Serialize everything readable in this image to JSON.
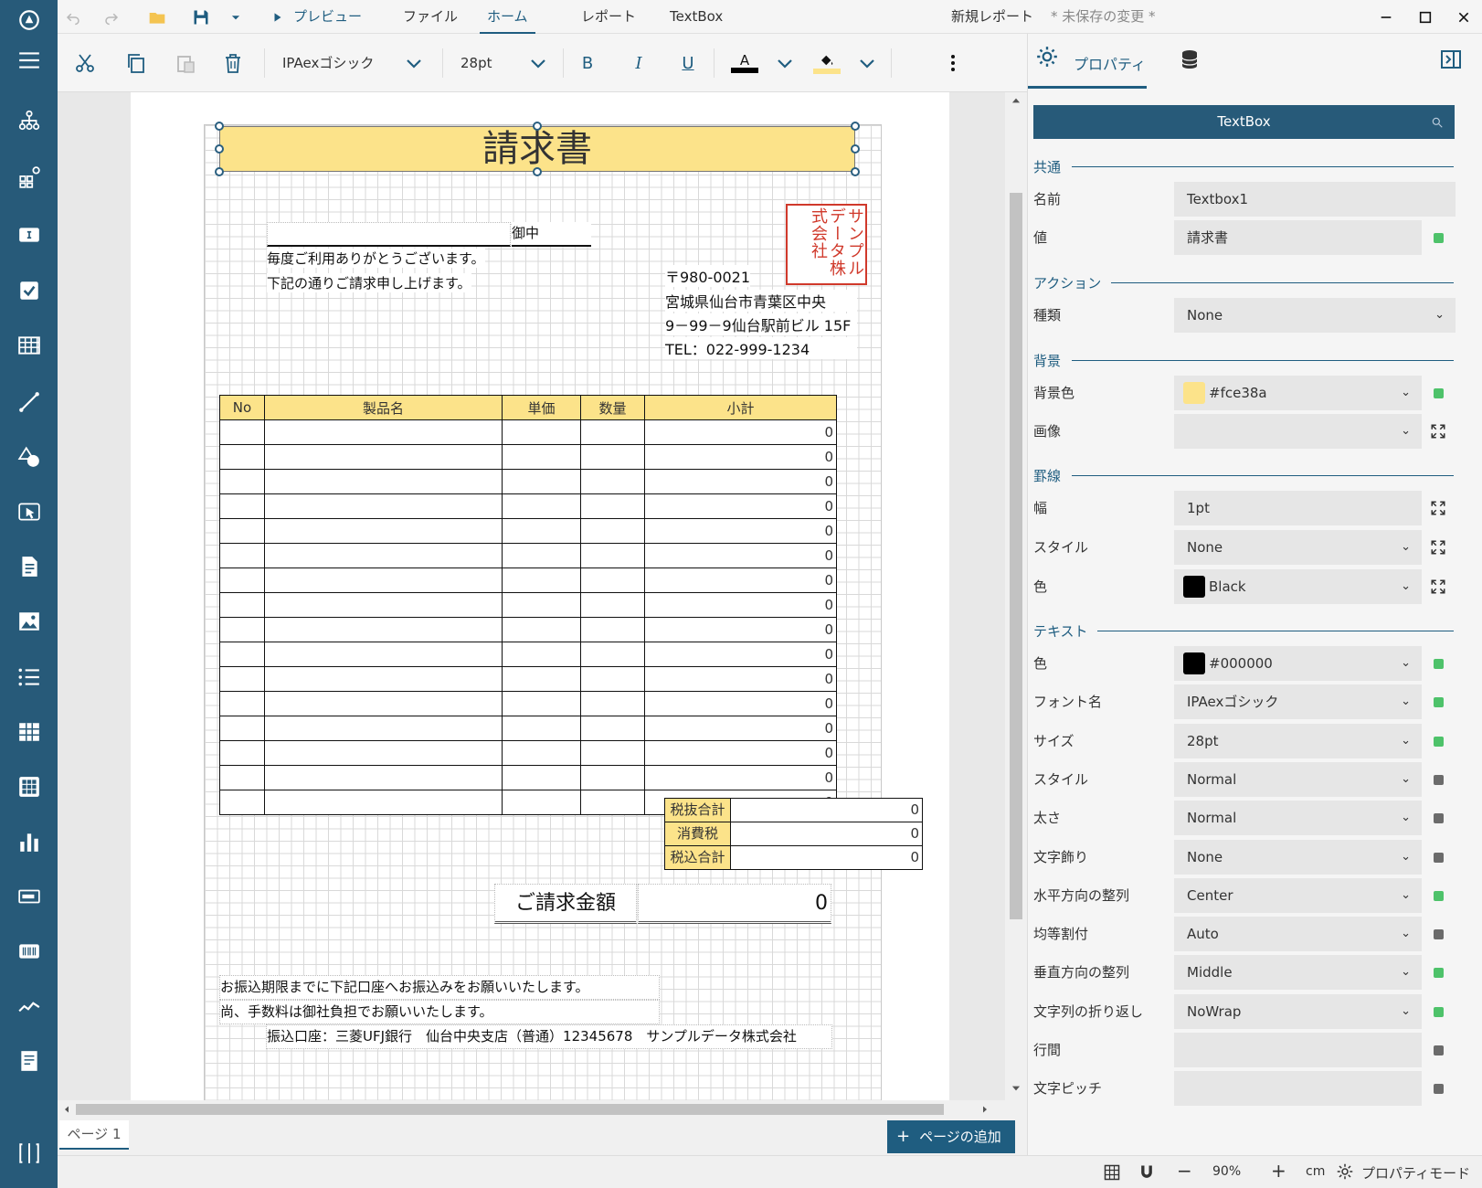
{
  "titlebar": {
    "menu_preview": "プレビュー",
    "menu_file": "ファイル",
    "menu_home": "ホーム",
    "menu_report": "レポート",
    "menu_textbox": "TextBox",
    "doc_name": "新規レポート",
    "unsaved": "* 未保存の変更 *"
  },
  "toolbar": {
    "font_name": "IPAexゴシック",
    "font_size": "28pt",
    "bold": "B",
    "italic": "I",
    "underline": "U",
    "font_color_letter": "A"
  },
  "report": {
    "title": "請求書",
    "onchu": "御中",
    "greeting1": "毎度ご利用ありがとうございます。",
    "greeting2": "下記の通りご請求申し上げます。",
    "stamp": "サンプルデータ株式会社",
    "postal": "〒980-0021",
    "address1": "宮城県仙台市青葉区中央",
    "address2": "9－99－9仙台駅前ビル 15F",
    "tel": "TEL：022-999-1234",
    "headers": [
      "No",
      "製品名",
      "単価",
      "数量",
      "小計"
    ],
    "row_subtotals": [
      "0",
      "0",
      "0",
      "0",
      "0",
      "0",
      "0",
      "0",
      "0",
      "0",
      "0",
      "0",
      "0",
      "0",
      "0",
      "0"
    ],
    "subtotal_label": "税抜合計",
    "tax_label": "消費税",
    "total_label": "税込合計",
    "subtotal_value": "0",
    "tax_value": "0",
    "total_value": "0",
    "amount_label": "ご請求金額",
    "amount_value": "0",
    "note1": "お振込期限までに下記口座へお振込みをお願いいたします。",
    "note2": "尚、手数料は御社負担でお願いいたします。",
    "bank": "振込口座：三菱UFJ銀行　仙台中央支店（普通）12345678　サンプルデータ株式会社"
  },
  "pagebar": {
    "page_tab": "ページ 1",
    "add_page": "ページの追加"
  },
  "statusbar": {
    "zoom": "90%",
    "unit": "cm",
    "mode": "プロパティモード"
  },
  "props": {
    "tab_label": "プロパティ",
    "search_value": "TextBox",
    "sections": {
      "common": "共通",
      "action": "アクション",
      "background": "背景",
      "border": "罫線",
      "text": "テキスト"
    },
    "name_label": "名前",
    "name_value": "Textbox1",
    "value_label": "値",
    "value_value": "請求書",
    "action_kind_label": "種類",
    "action_kind_value": "None",
    "bg_color_label": "背景色",
    "bg_color_value": "#fce38a",
    "image_label": "画像",
    "image_value": "",
    "border_width_label": "幅",
    "border_width_value": "1pt",
    "border_style_label": "スタイル",
    "border_style_value": "None",
    "border_color_label": "色",
    "border_color_value": "Black",
    "text_color_label": "色",
    "text_color_value": "#000000",
    "font_name_label": "フォント名",
    "font_name_value": "IPAexゴシック",
    "size_label": "サイズ",
    "size_value": "28pt",
    "style_label": "スタイル",
    "style_value": "Normal",
    "weight_label": "太さ",
    "weight_value": "Normal",
    "decoration_label": "文字飾り",
    "decoration_value": "None",
    "halign_label": "水平方向の整列",
    "halign_value": "Center",
    "justify_label": "均等割付",
    "justify_value": "Auto",
    "valign_label": "垂直方向の整列",
    "valign_value": "Middle",
    "wrap_label": "文字列の折り返し",
    "wrap_value": "NoWrap",
    "line_spacing_label": "行間",
    "line_spacing_value": "",
    "char_pitch_label": "文字ピッチ",
    "char_pitch_value": ""
  },
  "colors": {
    "sidebar": "#275a79",
    "accent": "#1f5d80",
    "title_bg": "#fce38a",
    "status_green": "#4ec26a",
    "stamp_red": "#d0392b"
  }
}
